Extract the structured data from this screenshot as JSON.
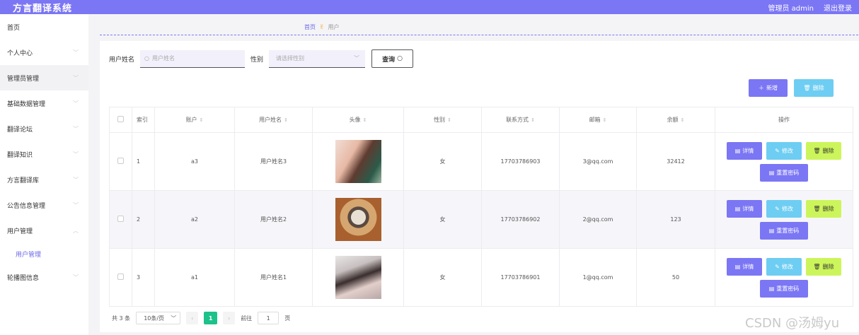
{
  "app": {
    "title": "方言翻译系统",
    "admin_label": "管理员 admin",
    "logout_label": "退出登录"
  },
  "sidebar": {
    "items": [
      {
        "label": "首页"
      },
      {
        "label": "个人中心"
      },
      {
        "label": "管理员管理"
      },
      {
        "label": "基础数据管理"
      },
      {
        "label": "翻译论坛"
      },
      {
        "label": "翻译知识"
      },
      {
        "label": "方言翻译库"
      },
      {
        "label": "公告信息管理"
      },
      {
        "label": "用户管理",
        "sub": "用户管理"
      },
      {
        "label": "轮播图信息"
      }
    ]
  },
  "breadcrumb": {
    "home": "首页",
    "current": "用户"
  },
  "search": {
    "name_label": "用户姓名",
    "name_placeholder": "用户姓名",
    "gender_label": "性别",
    "gender_placeholder": "请选择性别",
    "query_label": "查询"
  },
  "actions": {
    "add_label": "新增",
    "delete_label": "删除"
  },
  "table": {
    "columns": [
      "索引",
      "账户",
      "用户姓名",
      "头像",
      "性别",
      "联系方式",
      "邮箱",
      "余额",
      "操作"
    ],
    "rows": [
      {
        "index": "1",
        "account": "a3",
        "name": "用户姓名3",
        "gender": "女",
        "phone": "17703786903",
        "email": "3@qq.com",
        "balance": "32412"
      },
      {
        "index": "2",
        "account": "a2",
        "name": "用户姓名2",
        "gender": "女",
        "phone": "17703786902",
        "email": "2@qq.com",
        "balance": "123"
      },
      {
        "index": "3",
        "account": "a1",
        "name": "用户姓名1",
        "gender": "女",
        "phone": "17703786901",
        "email": "1@qq.com",
        "balance": "50"
      }
    ],
    "op_labels": {
      "detail": "详情",
      "edit": "修改",
      "remove": "删除",
      "reset": "重置密码"
    }
  },
  "pagination": {
    "total": "共 3 条",
    "page_size": "10条/页",
    "current_page": "1",
    "goto_label": "前往",
    "goto_value": "1",
    "page_suffix": "页"
  },
  "watermark": "CSDN @汤姆yu",
  "colors": {
    "primary": "#7b76f4",
    "info": "#6ecdf2",
    "warning": "#ccf55b",
    "active_page": "#1cc28a"
  }
}
